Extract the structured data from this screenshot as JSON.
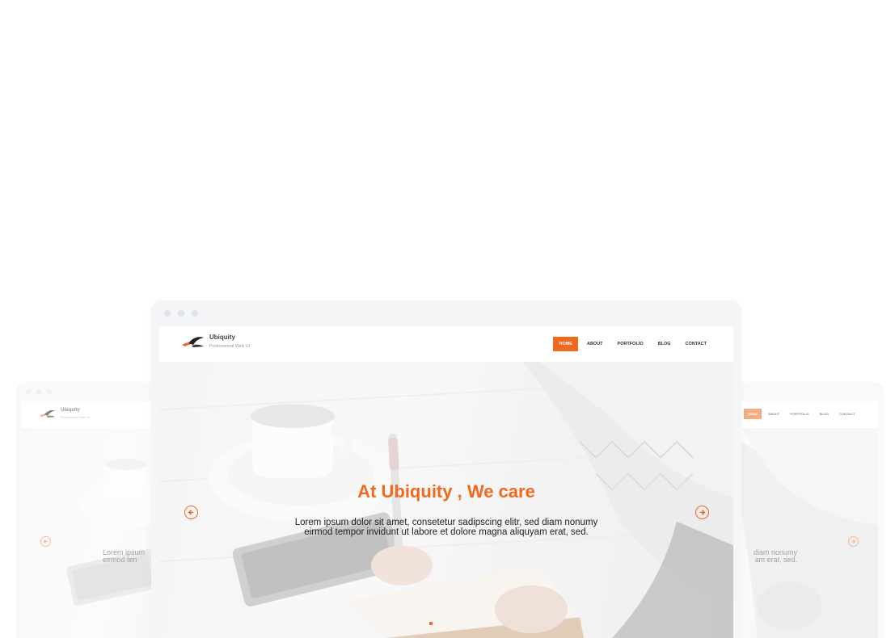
{
  "site": {
    "brand_name": "Ubiquity",
    "tagline": "Professional Web UI",
    "nav": [
      "HOME",
      "ABOUT",
      "PORTFOLIO",
      "BLOG",
      "CONTACT"
    ],
    "active_nav": "HOME"
  },
  "hero": {
    "title": "At Ubiquity , We care",
    "text_line1": "Lorem ipsum dolor sit amet, consetetur sadipscing elitr, sed diam nonumy",
    "text_line2": "eirmod tempor invidunt ut labore et dolore magna aliquyam erat, sed."
  },
  "left_preview": {
    "text_line1": "Lorem ipsum",
    "text_line2": "eirmod ten"
  },
  "right_preview": {
    "text_line1": "diam nonumy",
    "text_line2": "am erat, sed."
  },
  "colors": {
    "accent": "#ef6a1f",
    "frame": "#f3f5f7"
  },
  "icons": {
    "prev": "arrow-left-circle-icon",
    "next": "arrow-right-circle-icon"
  }
}
